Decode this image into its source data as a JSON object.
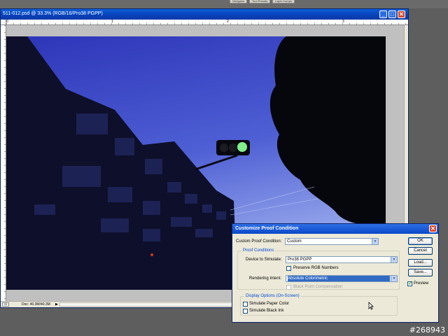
{
  "palette_tabs": [
    "Navigator",
    "Tool Presets",
    "Layer Comps"
  ],
  "document": {
    "title": "511-012.psd @ 33.3% (RGB/16/Pro38 PGPP)",
    "ruler_marks": [
      "0",
      "1",
      "2",
      "3"
    ],
    "status_zoom": "33",
    "status_doc": "Doc: 40.3M/40.3M",
    "status_arrow": "▶"
  },
  "window_buttons": {
    "minimize": "_",
    "maximize": "□",
    "close": "✕"
  },
  "dialog": {
    "title": "Customize Proof Condition",
    "close": "✕",
    "custom_label": "Custom Proof Condition:",
    "custom_value": "Custom",
    "proof_group": "Proof Conditions",
    "device_label": "Device to Simulate:",
    "device_value": "Pro38 PGPP",
    "preserve_label": "Preserve RGB Numbers",
    "preserve_checked": false,
    "intent_label": "Rendering Intent:",
    "intent_value": "Absolute Colorimetric",
    "bpc_label": "Black Point Compensation",
    "bpc_checked": false,
    "display_group": "Display Options (On-Screen)",
    "paper_label": "Simulate Paper Color",
    "paper_checked": false,
    "ink_label": "Simulate Black Ink",
    "ink_checked": false,
    "buttons": {
      "ok": "OK",
      "cancel": "Cancel",
      "load": "Load...",
      "save": "Save..."
    },
    "preview_label": "Preview",
    "preview_checked": true,
    "arrow": "▼"
  },
  "watermark": "#268943"
}
